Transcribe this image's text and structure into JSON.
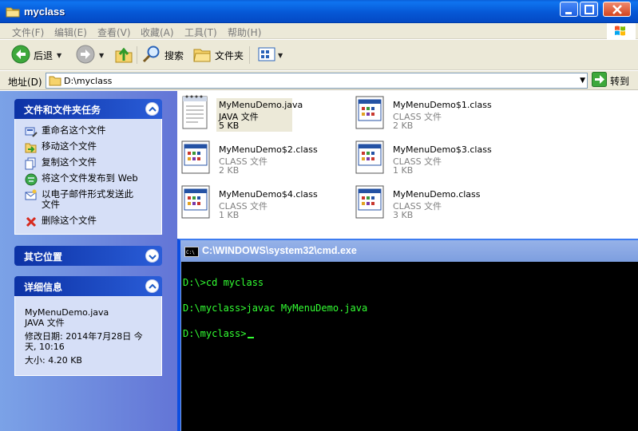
{
  "window": {
    "title": "myclass"
  },
  "menu": [
    "文件(F)",
    "编辑(E)",
    "查看(V)",
    "收藏(A)",
    "工具(T)",
    "帮助(H)"
  ],
  "toolbar": {
    "back": "后退",
    "search": "搜索",
    "folders": "文件夹"
  },
  "address": {
    "label": "地址(D)",
    "value": "D:\\myclass",
    "go": "转到"
  },
  "tasks": {
    "title": "文件和文件夹任务",
    "items": [
      {
        "label": "重命名这个文件",
        "icon": "rename-icon"
      },
      {
        "label": "移动这个文件",
        "icon": "move-icon"
      },
      {
        "label": "复制这个文件",
        "icon": "copy-icon"
      },
      {
        "label": "将这个文件发布到 Web",
        "icon": "globe-icon"
      },
      {
        "label": "以电子邮件形式发送此文件",
        "icon": "email-icon"
      },
      {
        "label": "删除这个文件",
        "icon": "delete-icon"
      }
    ]
  },
  "other_places": {
    "title": "其它位置"
  },
  "details": {
    "title": "详细信息",
    "name": "MyMenuDemo.java",
    "type": "JAVA 文件",
    "modified_line1": "修改日期: 2014年7月28日 今",
    "modified_line2": "天, 10:16",
    "size": "大小: 4.20 KB"
  },
  "files": [
    {
      "name": "MyMenuDemo.java",
      "type": "JAVA 文件",
      "size": "5 KB",
      "icon": "text-file-icon",
      "selected": true
    },
    {
      "name": "MyMenuDemo$1.class",
      "type": "CLASS 文件",
      "size": "2 KB",
      "icon": "class-file-icon"
    },
    {
      "name": "MyMenuDemo$2.class",
      "type": "CLASS 文件",
      "size": "2 KB",
      "icon": "class-file-icon"
    },
    {
      "name": "MyMenuDemo$3.class",
      "type": "CLASS 文件",
      "size": "1 KB",
      "icon": "class-file-icon"
    },
    {
      "name": "MyMenuDemo$4.class",
      "type": "CLASS 文件",
      "size": "1 KB",
      "icon": "class-file-icon"
    },
    {
      "name": "MyMenuDemo.class",
      "type": "CLASS 文件",
      "size": "3 KB",
      "icon": "class-file-icon"
    }
  ],
  "cmd": {
    "title": "C:\\WINDOWS\\system32\\cmd.exe",
    "icon_label": "C:\\",
    "lines": [
      "D:\\>cd myclass",
      "D:\\myclass>javac MyMenuDemo.java",
      "D:\\myclass>"
    ]
  }
}
